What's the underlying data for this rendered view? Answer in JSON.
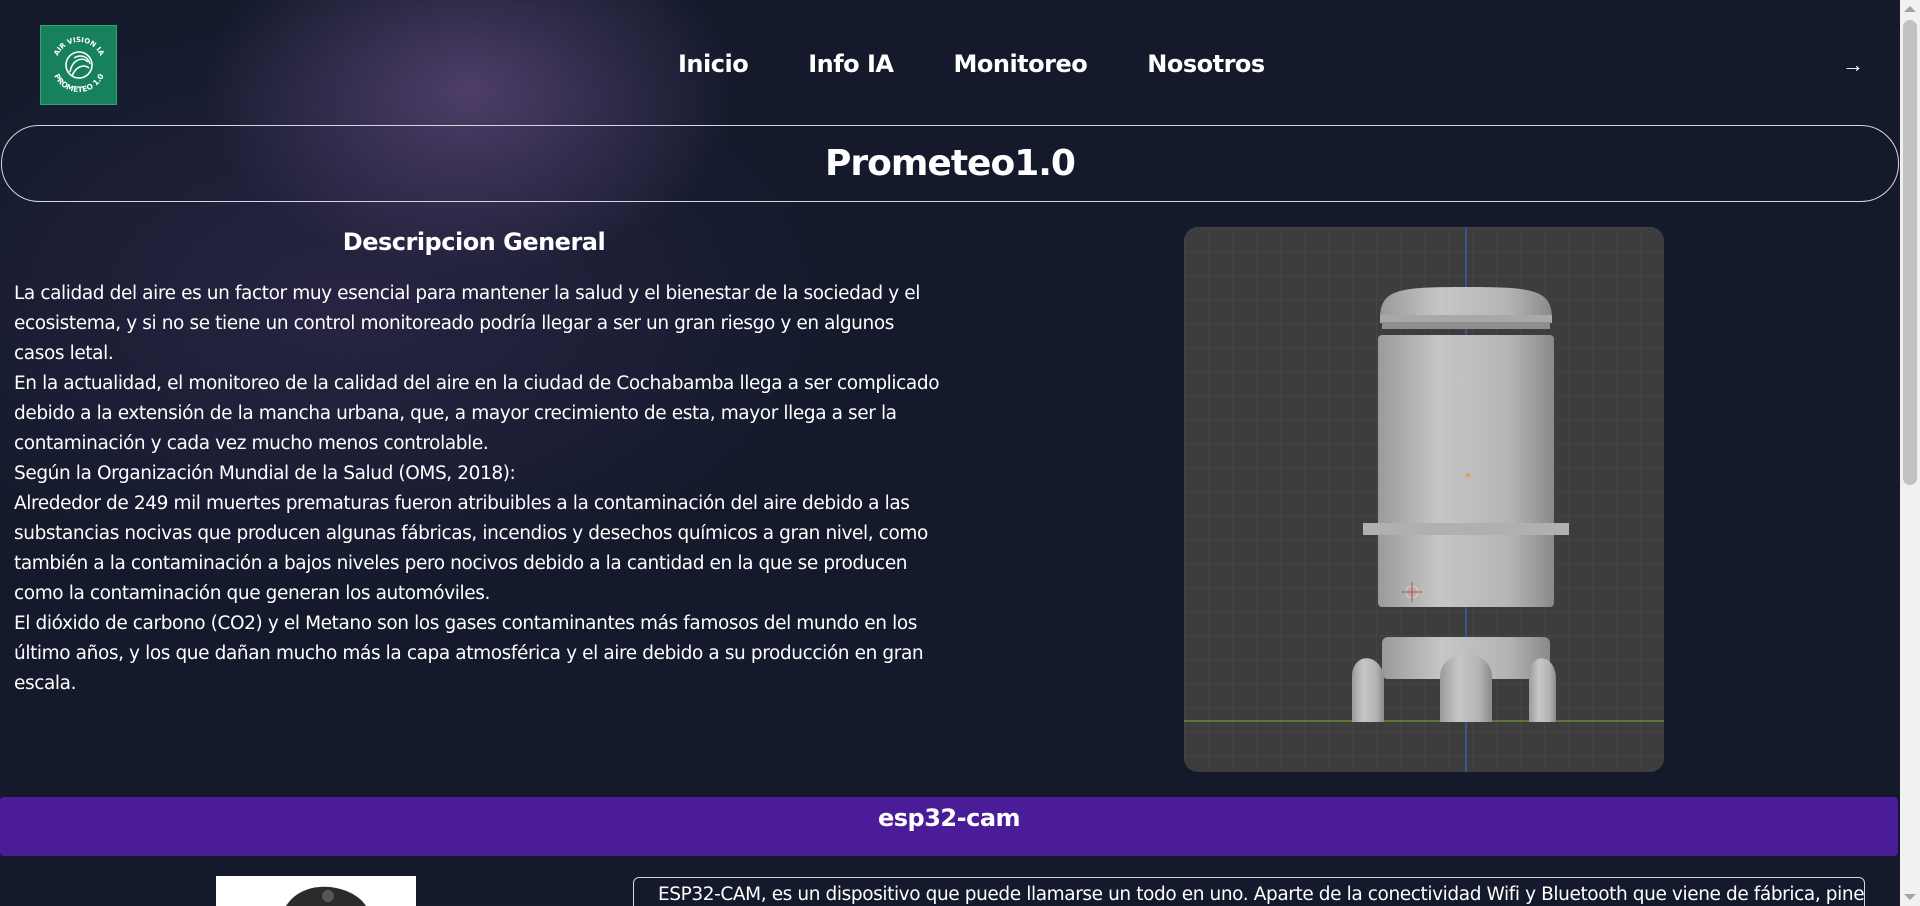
{
  "logo": {
    "text_top": "AIR VISION IA",
    "text_bottom": "PROMETEO 1.0",
    "color": "#17805c"
  },
  "nav": {
    "items": [
      "Inicio",
      "Info IA",
      "Monitoreo",
      "Nosotros"
    ],
    "login_icon": "→"
  },
  "title": "Prometeo1.0",
  "description": {
    "heading": "Descripcion General",
    "paragraphs": [
      "La calidad del aire es un factor muy esencial para mantener la salud y el bienestar de la sociedad y el ecosistema, y si no se tiene un control monitoreado podría llegar a ser un gran riesgo y en algunos casos letal.",
      "En la actualidad, el monitoreo de la calidad del aire en la ciudad de Cochabamba llega a ser complicado debido a la extensión de la mancha urbana, que, a mayor crecimiento de esta, mayor llega a ser la contaminación y cada vez mucho menos controlable.",
      "Según la Organización Mundial de la Salud (OMS, 2018):",
      "Alrededor de 249 mil muertes prematuras fueron atribuibles a la contaminación del aire debido a las substancias nocivas que producen algunas fábricas, incendios y desechos químicos a gran nivel, como también a la contaminación a bajos niveles pero nocivos debido a la cantidad en la que se producen como la contaminación que generan los automóviles.",
      "El dióxido de carbono (CO2) y el Metano son los gases contaminantes más famosos del mundo en los último años, y los que dañan mucho más la capa atmosférica y el aire debido a su producción en gran escala."
    ]
  },
  "section": {
    "title": "esp32-cam",
    "text": "ESP32-CAM, es un dispositivo que puede llamarse un todo en uno. Aparte de la conectividad Wifi y Bluetooth que viene de fábrica, pines"
  },
  "colors": {
    "background": "#141a2c",
    "section_bar": "#4b1c97",
    "viewport": "#3c3c3c"
  }
}
